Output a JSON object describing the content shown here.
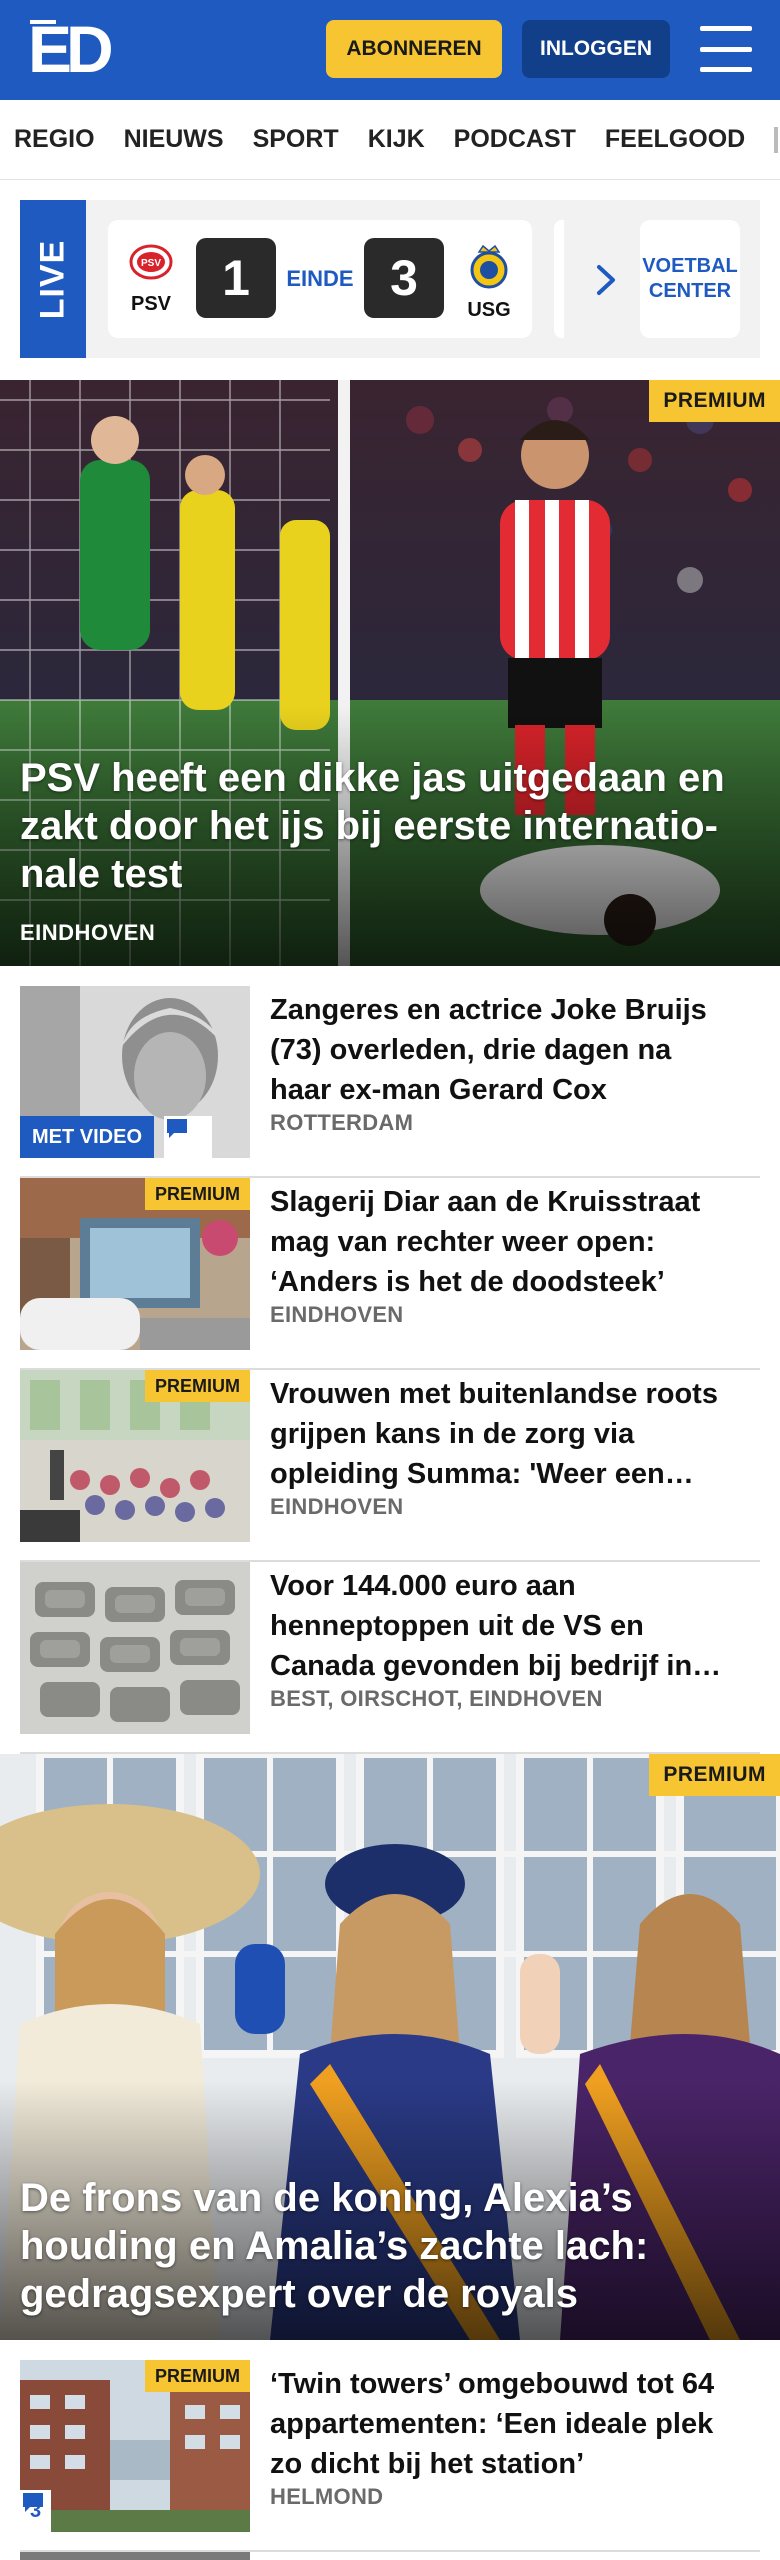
{
  "header": {
    "logo": "ED",
    "subscribe_label": "ABONNEREN",
    "login_label": "INLOGGEN",
    "brand_color": "#1f5ac0",
    "accent_color": "#f7c531"
  },
  "nav": {
    "items": [
      "REGIO",
      "NIEUWS",
      "SPORT",
      "KIJK",
      "PODCAST",
      "FEELGOOD"
    ]
  },
  "live": {
    "label": "LIVE",
    "match": {
      "home_team": "PSV",
      "home_score": "1",
      "status": "EINDE",
      "away_score": "3",
      "away_team": "USG"
    },
    "voetbal_center": "VOETBAL CENTER"
  },
  "hero1": {
    "badge": "PREMIUM",
    "title": "PSV heeft een dikke jas uitgedaan en zakt door het ijs bij eerste internatio-nale test",
    "location": "EINDHOVEN"
  },
  "articles1": [
    {
      "title": "Zangeres en actrice Joke Bruijs (73) overleden, drie dagen na haar ex-man Gerard Cox",
      "location": "ROTTERDAM",
      "video_label": "MET VIDEO"
    },
    {
      "badge": "PREMIUM",
      "title": "Slagerij Diar aan de Kruisstraat mag van rechter weer open: ‘Anders is het de doodsteek’",
      "location": "EINDHOVEN"
    },
    {
      "badge": "PREMIUM",
      "title": "Vrouwen met buitenlandse roots grijpen kans in de zorg via opleiding Summa: 'Weer een…",
      "location": "EINDHOVEN"
    },
    {
      "title": "Voor 144.000 euro aan henneptoppen uit de VS en Canada gevonden bij bedrijf in…",
      "location": "BEST, OIRSCHOT, EINDHOVEN"
    }
  ],
  "hero2": {
    "badge": "PREMIUM",
    "title": "De frons van de koning, Alexia’s houding en Amalia’s zachte lach: gedragsexpert over de royals"
  },
  "articles2": [
    {
      "badge": "PREMIUM",
      "title": "‘Twin towers’ omgebouwd tot 64 appartementen: ‘Een ideale plek zo dicht bij het station’",
      "location": "HELMOND",
      "comments": "3"
    }
  ]
}
